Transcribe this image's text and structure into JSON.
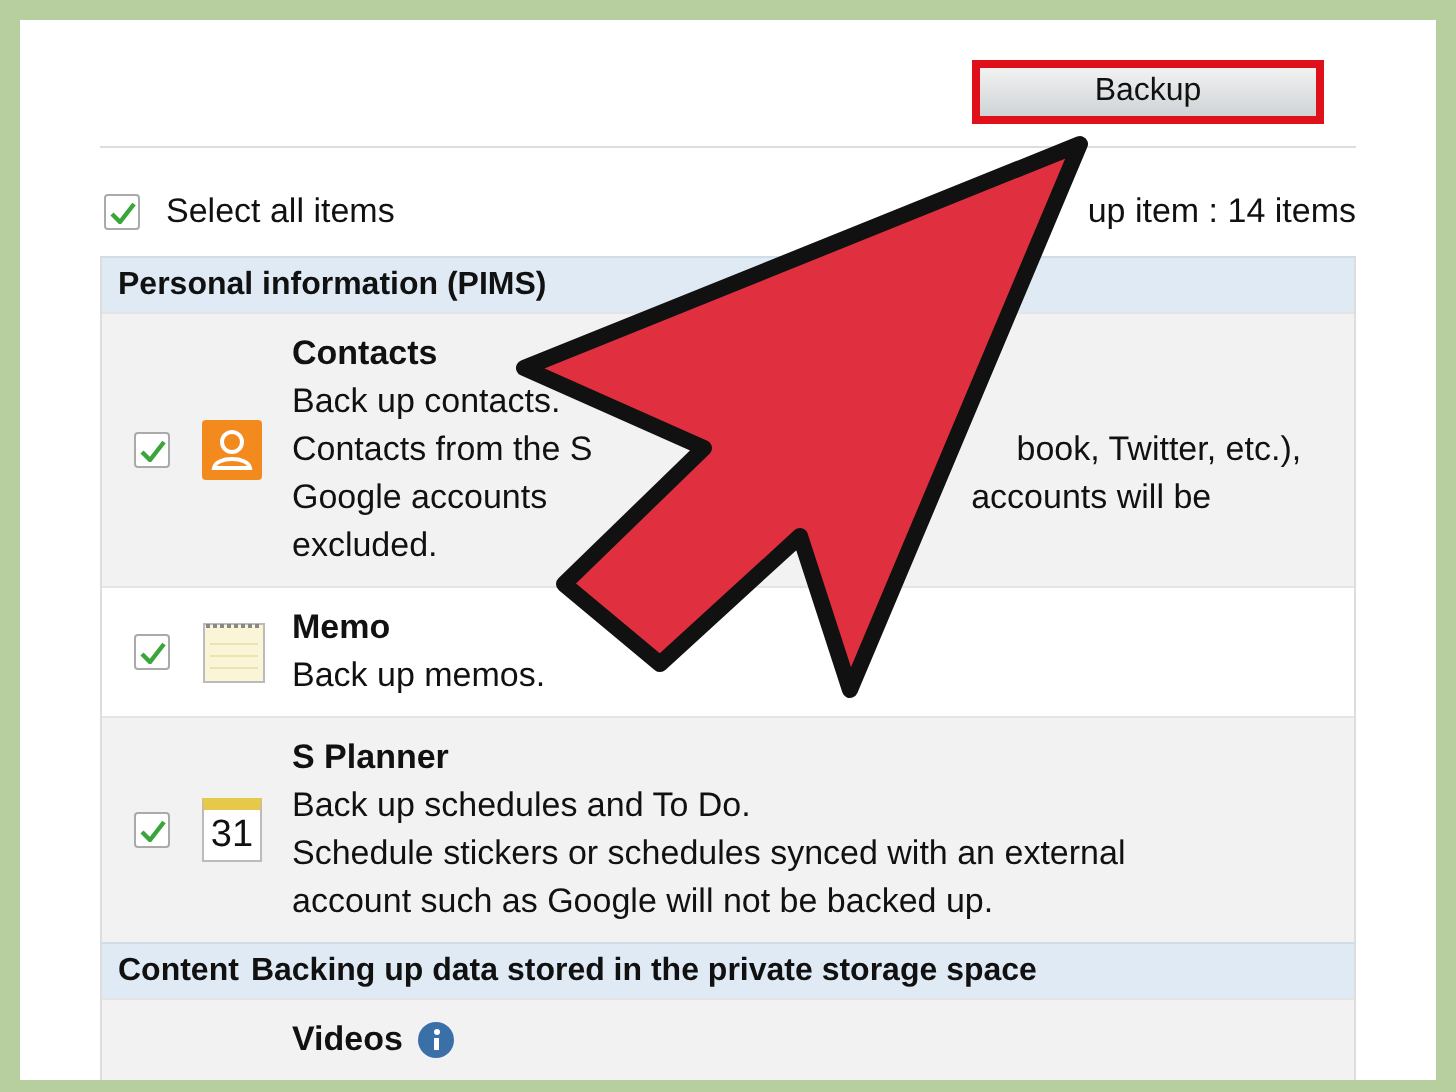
{
  "backup_button": {
    "label": "Backup",
    "highlighted": true
  },
  "select_all": {
    "label": "Select all items",
    "checked": true
  },
  "item_count": "up item : 14 items",
  "sections": [
    {
      "title": "Personal information (PIMS)",
      "items": [
        {
          "title": "Contacts",
          "kind": "contacts",
          "checked": true,
          "lines": [
            [
              "Back up contacts."
            ],
            [
              "Contacts from the S",
              "book, Twitter, etc.),"
            ],
            [
              "Google accounts",
              "accounts will be"
            ],
            [
              "excluded."
            ]
          ]
        },
        {
          "title": "Memo",
          "kind": "memo",
          "checked": true,
          "lines": [
            [
              "Back up memos."
            ]
          ]
        },
        {
          "title": "S Planner",
          "kind": "calendar",
          "icon_text": "31",
          "checked": true,
          "lines": [
            [
              "Back up schedules and To Do."
            ],
            [
              "Schedule stickers or schedules synced with an external"
            ],
            [
              "account such as Google will not be backed up."
            ]
          ]
        }
      ]
    },
    {
      "title": "Content",
      "subtitle": "Backing up data stored in the private storage space",
      "items": [
        {
          "title": "Videos",
          "info": true
        }
      ]
    }
  ]
}
